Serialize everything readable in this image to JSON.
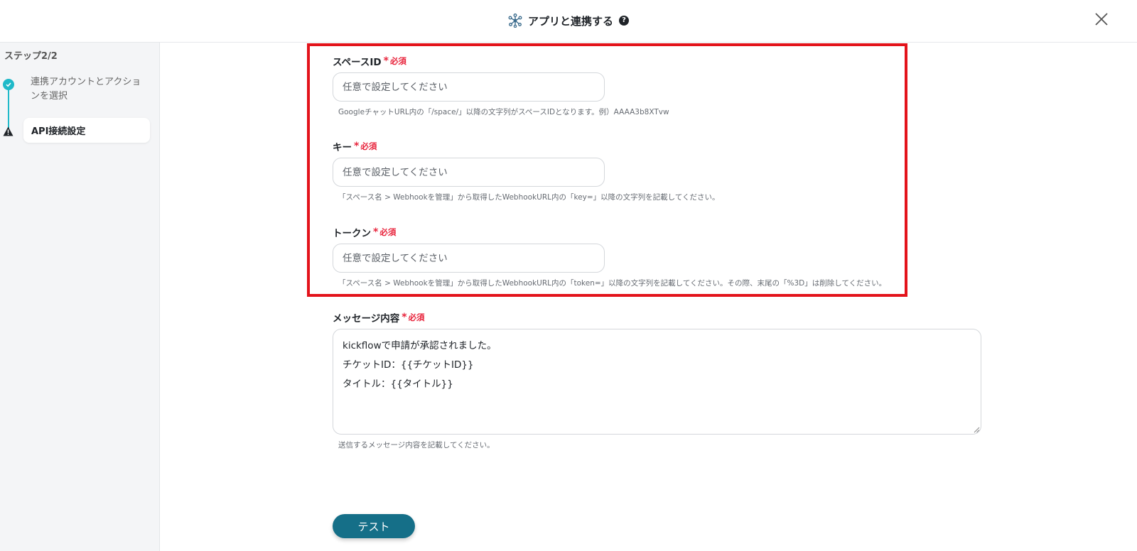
{
  "header": {
    "title": "アプリと連携する",
    "help_icon": "?",
    "icon": "network-hub-icon",
    "close_icon": "close-icon"
  },
  "sidebar": {
    "step_heading": "ステップ2/2",
    "steps": [
      {
        "label": "連携アカウントとアクションを選択",
        "status": "completed"
      },
      {
        "label": "API接続設定",
        "status": "warning"
      }
    ]
  },
  "form": {
    "required_label": "必須",
    "required_mark": "*",
    "space_id": {
      "label": "スペースID",
      "placeholder": "任意で設定してください",
      "hint": "GoogleチャットURL内の「/space/」以降の文字列がスペースIDとなります。例）AAAA3b8XTvw"
    },
    "key": {
      "label": "キー",
      "placeholder": "任意で設定してください",
      "hint": "「スペース名 > Webhookを管理」から取得したWebhookURL内の「key=」以降の文字列を記載してください。"
    },
    "token": {
      "label": "トークン",
      "placeholder": "任意で設定してください",
      "hint": "「スペース名 > Webhookを管理」から取得したWebhookURL内の「token=」以降の文字列を記載してください。その際、末尾の「%3D」は削除してください。"
    },
    "message": {
      "label": "メッセージ内容",
      "value": "kickflowで申請が承認されました。\nチケットID：{{チケットID}}\nタイトル：{{タイトル}}",
      "hint": "送信するメッセージ内容を記載してください。"
    },
    "test_button": "テスト"
  },
  "colors": {
    "accent": "#1fb9c9",
    "button": "#156f88",
    "required": "#e8243c",
    "highlight": "#e3131b"
  }
}
